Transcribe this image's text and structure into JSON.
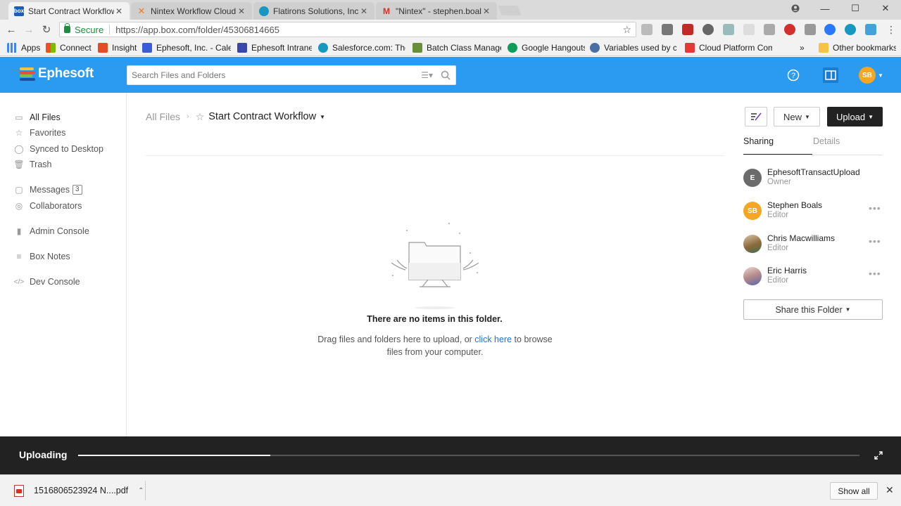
{
  "browser": {
    "tabs": [
      {
        "title": "Start Contract Workflow",
        "icon": "box-favicon",
        "active": true
      },
      {
        "title": "Nintex Workflow Cloud",
        "icon": "nintex-favicon",
        "active": false
      },
      {
        "title": "Flatirons Solutions, Inc | S",
        "icon": "salesforce-favicon",
        "active": false
      },
      {
        "title": "\"Nintex\" - stephen.boals",
        "icon": "gmail-favicon",
        "active": false
      }
    ],
    "window_controls": {
      "minimize": "—",
      "maximize": "☐",
      "close": "✕"
    },
    "address": {
      "secure_label": "Secure",
      "url": "https://app.box.com/folder/45306814665"
    },
    "bookmarks": [
      {
        "label": "Apps",
        "color": "#4285f4"
      },
      {
        "label": "Connect",
        "color": "#f25022"
      },
      {
        "label": "Insight",
        "color": "#e34c26"
      },
      {
        "label": "Ephesoft, Inc. - Calen",
        "color": "#3b5bdb"
      },
      {
        "label": "Ephesoft Intranet",
        "color": "#3949ab"
      },
      {
        "label": "Salesforce.com: The C",
        "color": "#1798c1"
      },
      {
        "label": "Batch Class Managen",
        "color": "#6a8f3a"
      },
      {
        "label": "Google Hangouts",
        "color": "#0f9d58"
      },
      {
        "label": "Variables used by cor",
        "color": "#4a6fa5"
      },
      {
        "label": "Cloud Platform Comp",
        "color": "#e53935"
      },
      {
        "label": "»",
        "color": ""
      },
      {
        "label": "Other bookmarks",
        "color": "#f6c344"
      }
    ]
  },
  "header": {
    "logo_text": "Ephesoft",
    "search_placeholder": "Search Files and Folders",
    "avatar_initials": "SB",
    "brand_color": "#2a9bf0"
  },
  "sidebar": {
    "items": [
      {
        "label": "All Files",
        "icon": "folder-icon",
        "badge": ""
      },
      {
        "label": "Favorites",
        "icon": "star-icon",
        "badge": ""
      },
      {
        "label": "Synced to Desktop",
        "icon": "check-circle-icon",
        "badge": ""
      },
      {
        "label": "Trash",
        "icon": "trash-icon",
        "badge": ""
      },
      {
        "label": "Messages",
        "icon": "message-icon",
        "badge": "3"
      },
      {
        "label": "Collaborators",
        "icon": "user-circle-icon",
        "badge": ""
      },
      {
        "label": "Admin Console",
        "icon": "bar-chart-icon",
        "badge": ""
      },
      {
        "label": "Box Notes",
        "icon": "notes-icon",
        "badge": ""
      },
      {
        "label": "Dev Console",
        "icon": "code-icon",
        "badge": ""
      }
    ]
  },
  "breadcrumb": {
    "root": "All Files",
    "current": "Start Contract Workflow"
  },
  "empty_state": {
    "title": "There are no items in this folder.",
    "desc_before": "Drag files and folders here to upload, or ",
    "link": "click here",
    "desc_after": " to browse files from your computer."
  },
  "actions": {
    "new_label": "New",
    "upload_label": "Upload"
  },
  "panel": {
    "tab_sharing": "Sharing",
    "tab_details": "Details",
    "collaborators": [
      {
        "name": "EphesoftTransactUpload",
        "role": "Owner",
        "initials": "E",
        "color": "#6b6b6b",
        "more": ""
      },
      {
        "name": "Stephen Boals",
        "role": "Editor",
        "initials": "SB",
        "color": "#f5a623",
        "more": "•••"
      },
      {
        "name": "Chris Macwilliams",
        "role": "Editor",
        "initials": "",
        "color": "#8c6a3d",
        "more": "•••"
      },
      {
        "name": "Eric Harris",
        "role": "Editor",
        "initials": "",
        "color": "#8a7aa8",
        "more": "•••"
      }
    ],
    "share_label": "Share this Folder"
  },
  "upload": {
    "title": "Uploading",
    "progress": 0.246
  },
  "download_shelf": {
    "filename": "1516806523924 N....pdf",
    "show_all": "Show all",
    "close": "✕"
  }
}
